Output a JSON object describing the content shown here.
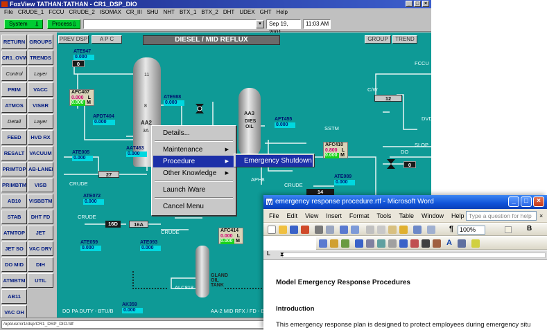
{
  "foxview": {
    "title": "FoxView TATHAN:TATHAN - CR1_DSP_DIO",
    "menu": [
      "File",
      "CRUDE_1",
      "FCCU",
      "CRUDE_2",
      "ISOMAX",
      "CR_III",
      "SHU",
      "NHT",
      "BTX_1",
      "BTX_2",
      "DHT",
      "UDEX",
      "GHT",
      "Help"
    ],
    "toolbar": {
      "system_label": "System",
      "process_label": "Process",
      "date": "Sep 19, 2001",
      "time": "11:03 AM"
    },
    "status_path": "/opt/usr/cr1/dsp/CR1_DSP_DIO.fdf"
  },
  "nav": [
    [
      "RETURN",
      "GROUPS"
    ],
    [
      "CR1_OVW",
      "TRENDS"
    ],
    [
      "Control",
      "Layer"
    ],
    [
      "PRIM",
      "VACC"
    ],
    [
      "ATMOS",
      "VISBR"
    ],
    [
      "Detail",
      "Layer"
    ],
    [
      "FEED",
      "HVD RX"
    ],
    [
      "RESALT",
      "VACUUM"
    ],
    [
      "PRIMTOP",
      "AB-LANED"
    ],
    [
      "PRIMBTM",
      "VISB"
    ],
    [
      "AB10",
      "VISBBTM"
    ],
    [
      "STAB",
      "DHT FD"
    ],
    [
      "ATMTOP",
      "JET"
    ],
    [
      "JET SO",
      "VAC DRY"
    ],
    [
      "DO MID",
      "DIH"
    ],
    [
      "ATMBTM",
      "UTIL"
    ],
    [
      "AB11",
      ""
    ],
    [
      "VAC OH",
      ""
    ]
  ],
  "display": {
    "buttons": {
      "prev_dsp": "PREV DSP",
      "apc": "A P C",
      "group": "GROUP",
      "trend": "TREND"
    },
    "title": "DIESEL / MID REFLUX",
    "tags": [
      {
        "tag": "ATE947",
        "val": "0.000"
      },
      {
        "tag": "APDT404",
        "val": "0.000"
      },
      {
        "tag": "ATE988",
        "val": "0.000"
      },
      {
        "tag": "AFT455",
        "val": "0.000"
      },
      {
        "tag": "ATE005",
        "val": "0.000"
      },
      {
        "tag": "AAT463",
        "val": "0.000"
      },
      {
        "tag": "ATE072",
        "val": "0.000"
      },
      {
        "tag": "ATE059",
        "val": "0.000"
      },
      {
        "tag": "ATE093",
        "val": "0.000"
      },
      {
        "tag": "ATE089",
        "val": "0.000"
      },
      {
        "tag": "AK359",
        "val": "0.000"
      }
    ],
    "controllers": [
      {
        "tag": "AFC407",
        "pv": "0.000",
        "out": "0.000",
        "l": "L",
        "m": "M"
      },
      {
        "tag": "AFC410",
        "pv": "0.800",
        "out": "0.000",
        "l": "L",
        "m": "M"
      },
      {
        "tag": "AFC414",
        "pv": "0.000",
        "out": "0.000",
        "l": "L",
        "m": "M"
      }
    ],
    "vessels": {
      "tower_tray_top": "11",
      "tower_tray_mid": "8",
      "tower_label": "AA2",
      "tower_sub": "3A",
      "stripper": "AA3",
      "stripper_sub1": "DIES",
      "stripper_sub2": "OIL",
      "tank1": "GLAND",
      "tank2": "OIL",
      "tank3": "TANK"
    },
    "blocks": {
      "b0": "0",
      "b27": "27",
      "b16d": "16D",
      "b16a": "16A",
      "b14": "14",
      "b12": "12",
      "b0r": "0"
    },
    "labels": {
      "fccu": "FCCU",
      "cw": "C/W",
      "dvd": "DVD",
      "slop": "SLOP",
      "do": "DO",
      "sstm": "SSTM",
      "crude1": "CRUDE",
      "crude2": "CRUDE",
      "crude3": "CRUDE",
      "crude4": "CRUDE",
      "aph8": "APH8",
      "alc818": "ALC818",
      "bottom_left": "DO PA DUTY - BTU/B",
      "bottom_right": "AA-2 MID RFX / FD - B/B"
    }
  },
  "context_menu": {
    "items": [
      "Details...",
      "Maintenance",
      "Procedure",
      "Other Knowledge",
      "Launch iWare",
      "Cancel Menu"
    ],
    "submenu": "Emergency Shutdown"
  },
  "word": {
    "title": "emergency response procedure.rtf - Microsoft Word",
    "menu": [
      "File",
      "Edit",
      "View",
      "Insert",
      "Format",
      "Tools",
      "Table",
      "Window",
      "Help"
    ],
    "help_placeholder": "Type a question for help",
    "zoom": "100%",
    "heading": "Model Emergency Response Procedures",
    "subheading": "Introduction",
    "paragraph": "This emergency response plan is designed to protect employees during emergency situ"
  },
  "colors": {
    "process_bg": "#0e9a96",
    "value_cyan": "#00d8e0",
    "menu_select": "#1c2fa8",
    "green_btn": "#00cc33"
  }
}
